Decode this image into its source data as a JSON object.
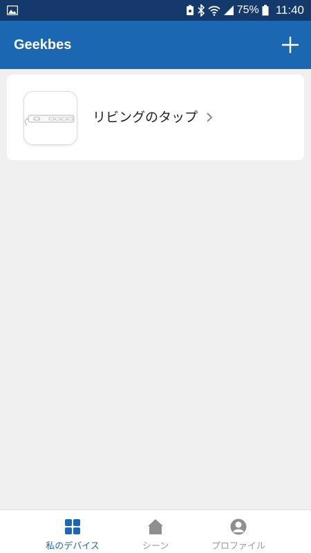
{
  "status_bar": {
    "battery_percent": "75%",
    "time": "11:40"
  },
  "app_bar": {
    "title": "Geekbes",
    "add_icon": "plus-icon"
  },
  "devices": [
    {
      "name": "リビングのタップ",
      "thumbnail_icon": "power-strip-icon",
      "chevron_icon": "chevron-right-icon"
    }
  ],
  "bottom_nav": {
    "items": [
      {
        "label": "私のデバイス",
        "icon": "grid-icon",
        "active": true
      },
      {
        "label": "シーン",
        "icon": "home-icon",
        "active": false
      },
      {
        "label": "プロファイル",
        "icon": "user-icon",
        "active": false
      }
    ]
  },
  "colors": {
    "status_bar": "#143a6b",
    "app_bar": "#1c67b1",
    "background": "#f0f0f0",
    "accent": "#1c67b1",
    "inactive": "#9a9a9a"
  }
}
